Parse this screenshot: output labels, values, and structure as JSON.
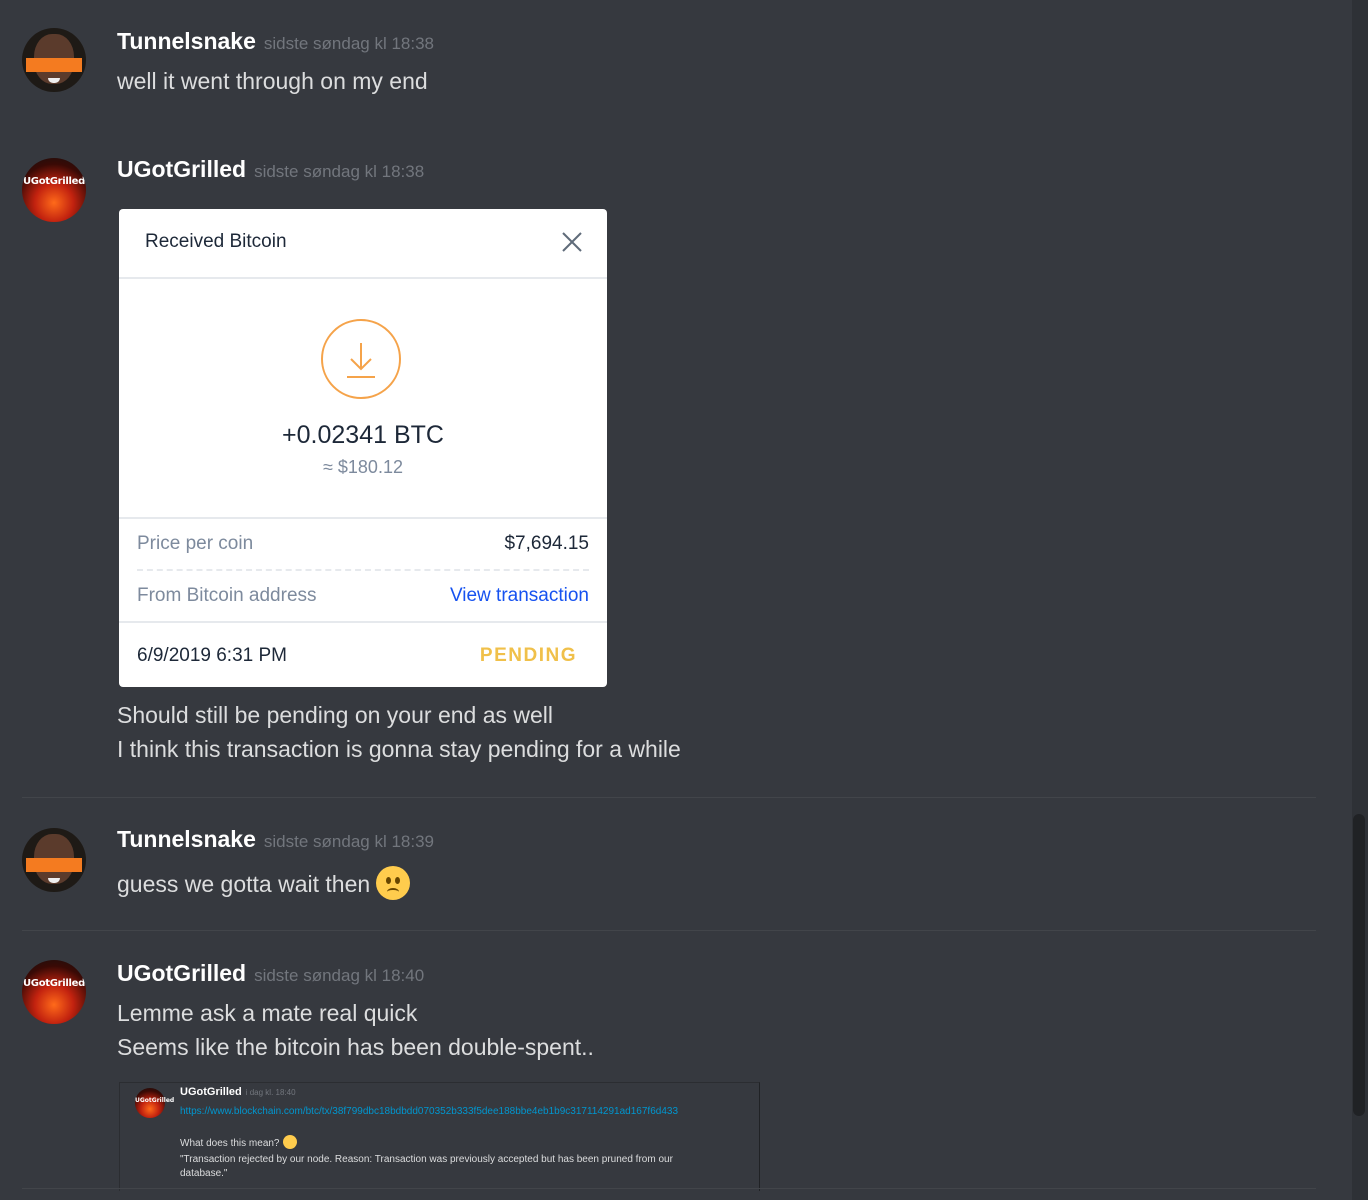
{
  "messages": [
    {
      "author": "Tunnelsnake",
      "timestamp": "sidste søndag kl 18:38",
      "lines": [
        "well it went through on my end"
      ]
    },
    {
      "author": "UGotGrilled",
      "avatar_text": "UGotGrilled",
      "timestamp": "sidste søndag kl 18:38",
      "lines": [
        "Should still be pending on your end as well",
        "I think this transaction is gonna stay pending for a while"
      ]
    },
    {
      "author": "Tunnelsnake",
      "timestamp": "sidste søndag kl 18:39",
      "lines": [
        "guess we gotta wait then"
      ]
    },
    {
      "author": "UGotGrilled",
      "avatar_text": "UGotGrilled",
      "timestamp": "sidste søndag kl 18:40",
      "lines": [
        "Lemme ask a mate real quick",
        "Seems like the bitcoin has been double-spent.."
      ]
    }
  ],
  "bitcoin_card": {
    "title": "Received Bitcoin",
    "amount": "+0.02341 BTC",
    "usd": "≈ $180.12",
    "price_label": "Price per coin",
    "price_value": "$7,694.15",
    "from_label": "From Bitcoin address",
    "view_link": "View transaction",
    "date": "6/9/2019 6:31 PM",
    "status": "PENDING",
    "colors": {
      "accent": "#f5a34a",
      "link": "#1652f0",
      "pending": "#f0c04a"
    }
  },
  "embed": {
    "avatar_text": "UGotGrilled",
    "author": "UGotGrilled",
    "timestamp": "i dag kl. 18:40",
    "link": "https://www.blockchain.com/btc/tx/38f799dbc18bdbdd070352b333f5dee188bbe4eb1b9c317114291ad167f6d433",
    "question": "What does this mean?",
    "quote_line1": "\"Transaction rejected by our node. Reason: Transaction was previously accepted but has been pruned from our",
    "quote_line2": "database.\""
  },
  "icons": {
    "close": "close-icon",
    "download": "download-icon",
    "frowning_emoji": "frowning-face-emoji",
    "open_mouth_emoji": "open-mouth-face-emoji"
  }
}
